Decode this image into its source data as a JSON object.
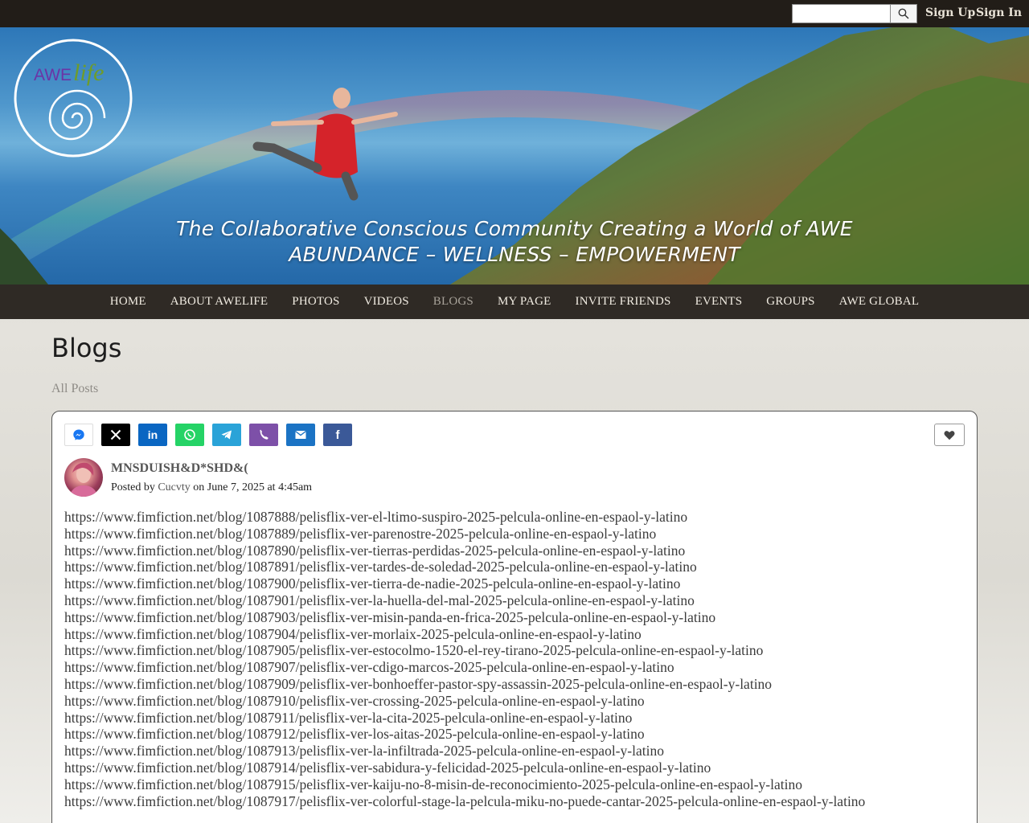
{
  "topbar": {
    "search_placeholder": "",
    "signup_label": "Sign Up",
    "signin_label": "Sign In"
  },
  "banner": {
    "logo_text_awe": "AWE",
    "logo_text_life": "life",
    "tagline_line1": "The Collaborative Conscious Community Creating a World of AWE",
    "tagline_line2": "ABUNDANCE – WELLNESS – EMPOWERMENT"
  },
  "nav": {
    "items": [
      {
        "label": "HOME"
      },
      {
        "label": "ABOUT AWELIFE"
      },
      {
        "label": "PHOTOS"
      },
      {
        "label": "VIDEOS"
      },
      {
        "label": "BLOGS"
      },
      {
        "label": "MY PAGE"
      },
      {
        "label": "INVITE FRIENDS"
      },
      {
        "label": "EVENTS"
      },
      {
        "label": "GROUPS"
      },
      {
        "label": "AWE GLOBAL"
      }
    ],
    "active": "BLOGS"
  },
  "page": {
    "title": "Blogs",
    "all_posts_link": "All Posts"
  },
  "share": {
    "buttons": [
      {
        "icon": "messenger-icon",
        "color": "#ffffff"
      },
      {
        "icon": "x-icon",
        "color": "#000000"
      },
      {
        "icon": "linkedin-icon",
        "color": "#0a66c2"
      },
      {
        "icon": "whatsapp-icon",
        "color": "#25d366"
      },
      {
        "icon": "telegram-icon",
        "color": "#2aa3d8"
      },
      {
        "icon": "viber-icon",
        "color": "#7d50a8"
      },
      {
        "icon": "email-icon",
        "color": "#1b73c4"
      },
      {
        "icon": "facebook-icon",
        "color": "#3b5998"
      }
    ]
  },
  "post": {
    "title": "MNSDUISH&D*SHD&(",
    "meta_prefix": "Posted by",
    "author": "Cucvty",
    "meta_date": "on June 7, 2025 at 4:45am",
    "lines": [
      "https://www.fimfiction.net/blog/1087888/pelisflix-ver-el-ltimo-suspiro-2025-pelcula-online-en-espaol-y-latino",
      "https://www.fimfiction.net/blog/1087889/pelisflix-ver-parenostre-2025-pelcula-online-en-espaol-y-latino",
      "https://www.fimfiction.net/blog/1087890/pelisflix-ver-tierras-perdidas-2025-pelcula-online-en-espaol-y-latino",
      "https://www.fimfiction.net/blog/1087891/pelisflix-ver-tardes-de-soledad-2025-pelcula-online-en-espaol-y-latino",
      "https://www.fimfiction.net/blog/1087900/pelisflix-ver-tierra-de-nadie-2025-pelcula-online-en-espaol-y-latino",
      "https://www.fimfiction.net/blog/1087901/pelisflix-ver-la-huella-del-mal-2025-pelcula-online-en-espaol-y-latino",
      "https://www.fimfiction.net/blog/1087903/pelisflix-ver-misin-panda-en-frica-2025-pelcula-online-en-espaol-y-latino",
      "https://www.fimfiction.net/blog/1087904/pelisflix-ver-morlaix-2025-pelcula-online-en-espaol-y-latino",
      "https://www.fimfiction.net/blog/1087905/pelisflix-ver-estocolmo-1520-el-rey-tirano-2025-pelcula-online-en-espaol-y-latino",
      "https://www.fimfiction.net/blog/1087907/pelisflix-ver-cdigo-marcos-2025-pelcula-online-en-espaol-y-latino",
      "https://www.fimfiction.net/blog/1087909/pelisflix-ver-bonhoeffer-pastor-spy-assassin-2025-pelcula-online-en-espaol-y-latino",
      "https://www.fimfiction.net/blog/1087910/pelisflix-ver-crossing-2025-pelcula-online-en-espaol-y-latino",
      "https://www.fimfiction.net/blog/1087911/pelisflix-ver-la-cita-2025-pelcula-online-en-espaol-y-latino",
      "https://www.fimfiction.net/blog/1087912/pelisflix-ver-los-aitas-2025-pelcula-online-en-espaol-y-latino",
      "https://www.fimfiction.net/blog/1087913/pelisflix-ver-la-infiltrada-2025-pelcula-online-en-espaol-y-latino",
      "https://www.fimfiction.net/blog/1087914/pelisflix-ver-sabidura-y-felicidad-2025-pelcula-online-en-espaol-y-latino",
      "https://www.fimfiction.net/blog/1087915/pelisflix-ver-kaiju-no-8-misin-de-reconocimiento-2025-pelcula-online-en-espaol-y-latino",
      "https://www.fimfiction.net/blog/1087917/pelisflix-ver-colorful-stage-la-pelcula-miku-no-puede-cantar-2025-pelcula-online-en-espaol-y-latino"
    ]
  }
}
